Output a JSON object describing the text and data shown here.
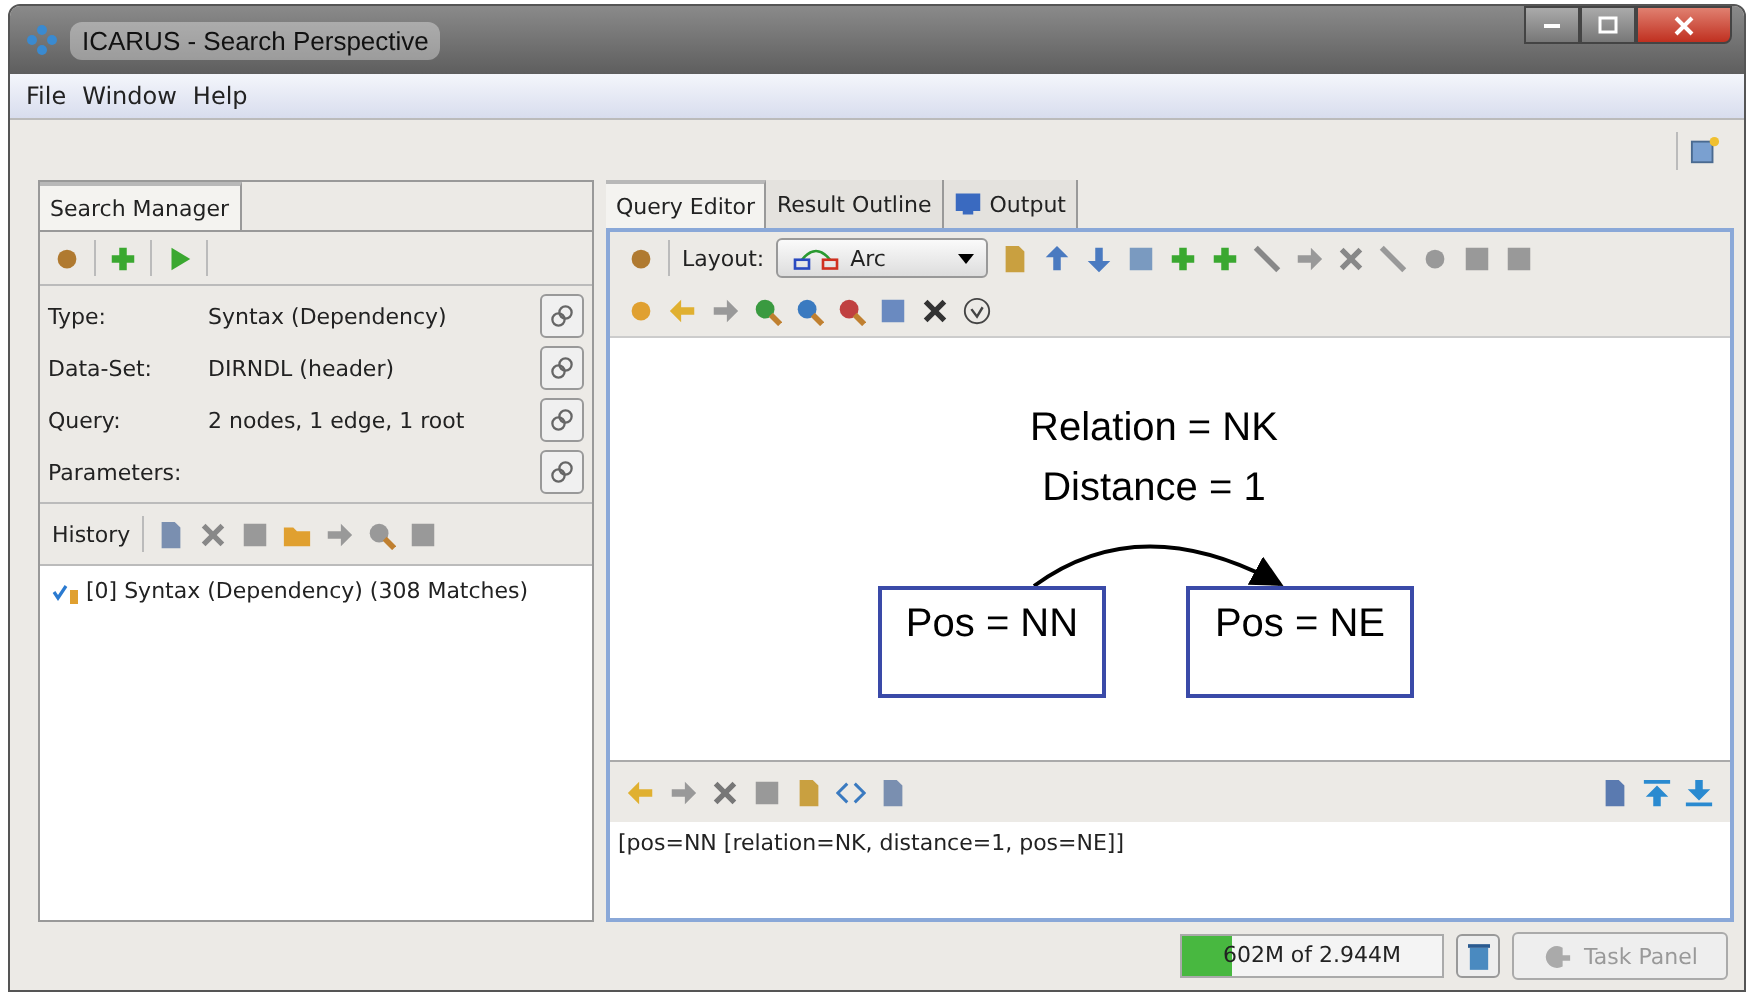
{
  "window": {
    "title": "ICARUS - Search Perspective"
  },
  "menu": [
    "File",
    "Window",
    "Help"
  ],
  "search_manager": {
    "tab": "Search Manager",
    "properties": [
      {
        "label": "Type:",
        "value": "Syntax (Dependency)"
      },
      {
        "label": "Data-Set:",
        "value": "DIRNDL (header)"
      },
      {
        "label": "Query:",
        "value": "2 nodes, 1 edge, 1 root"
      },
      {
        "label": "Parameters:"
      }
    ],
    "history_label": "History",
    "history": [
      {
        "text": "[0] Syntax (Dependency) (308 Matches)"
      }
    ]
  },
  "editor": {
    "tabs": [
      {
        "label": "Query Editor",
        "selected": true
      },
      {
        "label": "Result Outline",
        "selected": false
      },
      {
        "label": "Output",
        "selected": false
      }
    ],
    "layout_label": "Layout:",
    "layout_value": "Arc",
    "edge_labels": [
      "Relation = NK",
      "Distance = 1"
    ],
    "nodes": [
      {
        "label": "Pos = NN"
      },
      {
        "label": "Pos = NE"
      }
    ],
    "query_text": "[pos=NN [relation=NK, distance=1, pos=NE]]"
  },
  "status_bar": {
    "memory": "602M of 2.944M",
    "level": 0.19,
    "task_panel": {
      "label": "Task Panel",
      "disabled": true
    }
  }
}
